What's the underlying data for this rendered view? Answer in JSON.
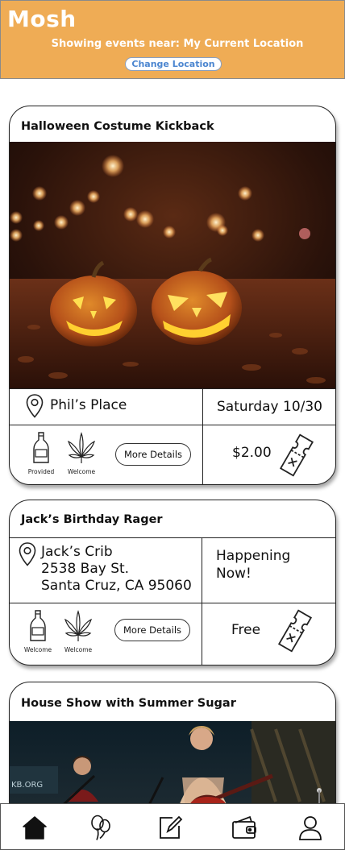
{
  "app": {
    "name": "Mosh"
  },
  "header": {
    "location_text": "Showing events near: My Current Location",
    "change_location_label": "Change Location"
  },
  "colors": {
    "header_bg": "#efac55",
    "accent_link": "#4c86d0"
  },
  "events": [
    {
      "title": "Halloween Costume Kickback",
      "venue_lines": [
        "Phil’s Place"
      ],
      "when_lines": [
        "Saturday 10/30"
      ],
      "amenities": [
        {
          "icon": "bottle-icon",
          "label": "Provided"
        },
        {
          "icon": "cannabis-leaf-icon",
          "label": "Welcome"
        }
      ],
      "more_details_label": "More Details",
      "price": "$2.00",
      "image": "halloween-pumpkins-photo"
    },
    {
      "title": "Jack’s Birthday Rager",
      "venue_lines": [
        "Jack’s Crib",
        "2538 Bay St.",
        "Santa Cruz, CA 95060"
      ],
      "when_lines": [
        "Happening",
        "Now!"
      ],
      "amenities": [
        {
          "icon": "bottle-icon",
          "label": "Welcome"
        },
        {
          "icon": "cannabis-leaf-icon",
          "label": "Welcome"
        }
      ],
      "more_details_label": "More Details",
      "price": "Free"
    },
    {
      "title": "House Show with Summer Sugar",
      "image": "live-band-photo"
    }
  ],
  "nav": [
    {
      "icon": "home-icon"
    },
    {
      "icon": "balloons-icon"
    },
    {
      "icon": "edit-icon"
    },
    {
      "icon": "wallet-icon"
    },
    {
      "icon": "profile-icon"
    }
  ]
}
